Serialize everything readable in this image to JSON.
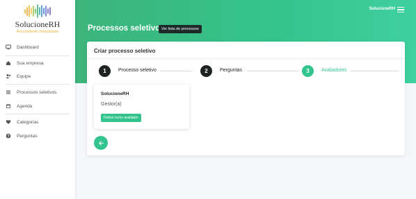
{
  "brand": {
    "name": "SolucioneRH",
    "tagline": "Recrutamento Humanizado",
    "colors": {
      "accent": "#33c48e",
      "dark": "#1e2321",
      "tagline": "#e7b53a"
    }
  },
  "sidebar": {
    "items": [
      {
        "label": "Dashboard",
        "icon": "monitor-icon"
      },
      {
        "label": "Sua empresa",
        "icon": "home-icon"
      },
      {
        "label": "Equipe",
        "icon": "users-icon"
      },
      {
        "label": "Processos seletivos",
        "icon": "list-icon"
      },
      {
        "label": "Agenda",
        "icon": "calendar-icon"
      },
      {
        "label": "Categorias",
        "icon": "heart-icon"
      },
      {
        "label": "Perguntas",
        "icon": "question-icon"
      }
    ]
  },
  "header": {
    "user": "SolucioneRH",
    "title": "Processos seletivos",
    "list_button": "Ver lista de processos"
  },
  "card": {
    "title": "Criar processo seletivo",
    "steps": [
      {
        "number": "1",
        "label": "Processo seletivo",
        "active": false
      },
      {
        "number": "2",
        "label": "Perguntas",
        "active": false
      },
      {
        "number": "3",
        "label": "Avaliadores",
        "active": true
      }
    ],
    "evaluator": {
      "name": "SolucioneRH",
      "role": "Gestor(a)",
      "button": "Definir como avaliador"
    }
  }
}
